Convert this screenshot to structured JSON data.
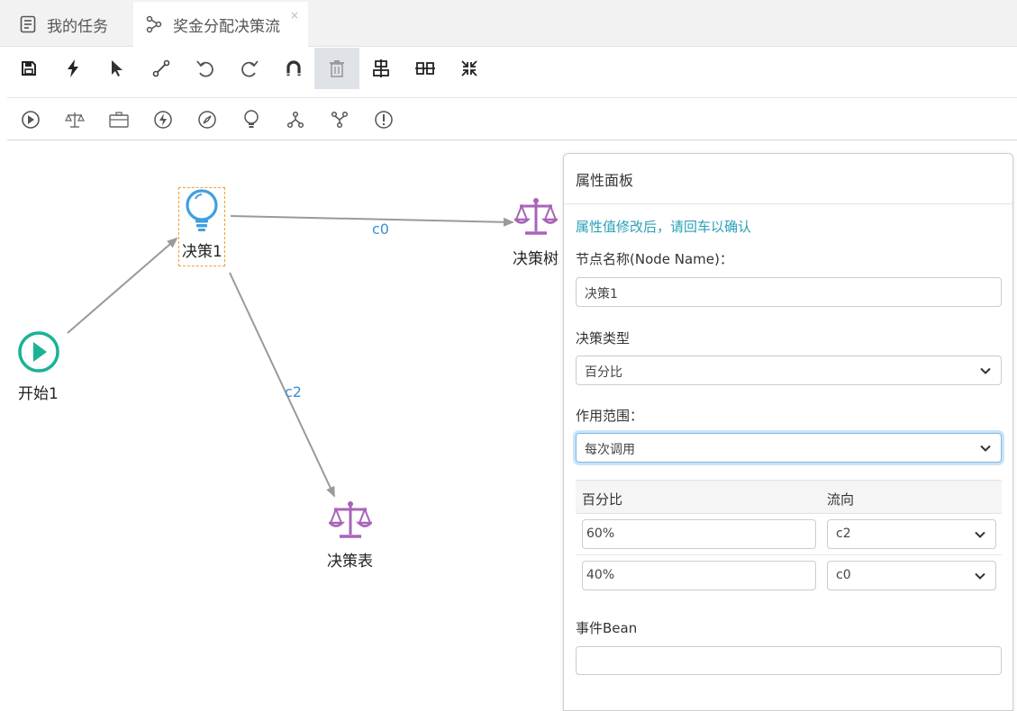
{
  "tabs": [
    {
      "label": "我的任务",
      "icon": "task-list-icon"
    },
    {
      "label": "奖金分配决策流",
      "icon": "flow-icon",
      "close": "×"
    }
  ],
  "toolbar_main": [
    "save-icon",
    "bolt-icon",
    "pointer-icon",
    "connector-icon",
    "undo-icon",
    "redo-icon",
    "magnet-icon",
    "trash-icon",
    "align-vertical-icon",
    "align-horizontal-icon",
    "compress-icon"
  ],
  "toolbar_nodes": [
    "start-node-icon",
    "decision-scale-icon",
    "briefcase-icon",
    "action-bolt-icon",
    "script-compass-icon",
    "decision-bulb-icon",
    "fork-icon",
    "join-icon",
    "end-exclamation-icon"
  ],
  "canvas": {
    "nodes": {
      "start": "开始1",
      "decision": "决策1",
      "tree": "决策树",
      "table": "决策表"
    },
    "edges": {
      "c0": "c0",
      "c2": "c2"
    }
  },
  "panel": {
    "title": "属性面板",
    "hint": "属性值修改后，请回车以确认",
    "node_name_label": "节点名称(Node Name)：",
    "node_name_value": "决策1",
    "decision_type_label": "决策类型",
    "decision_type_value": "百分比",
    "scope_label": "作用范围：",
    "scope_value": "每次调用",
    "table_headers": [
      "百分比",
      "流向"
    ],
    "rows": [
      {
        "percent": "60%",
        "flow": "c2"
      },
      {
        "percent": "40%",
        "flow": "c0"
      }
    ],
    "event_bean_label": "事件Bean",
    "event_bean_value": ""
  },
  "colors": {
    "accent_teal": "#1ab394",
    "node_purple": "#a864b8",
    "bulb_blue": "#3ea0e0",
    "edge_label": "#3a8fd8",
    "hint": "#2aa0b8"
  }
}
